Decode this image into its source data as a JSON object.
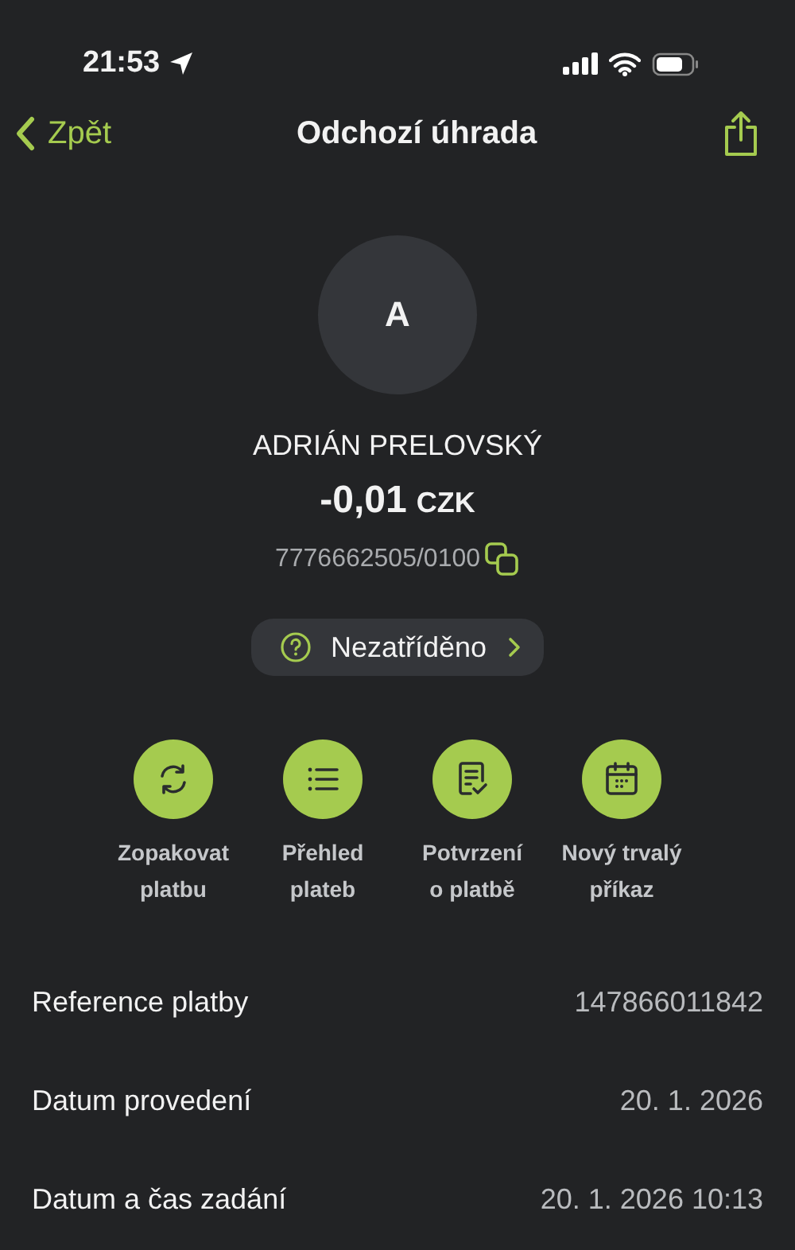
{
  "status_bar": {
    "time": "21:53"
  },
  "nav": {
    "back": "Zpět",
    "title": "Odchozí úhrada"
  },
  "counterparty": {
    "initial": "A",
    "name": "ADRIÁN PRELOVSKÝ",
    "amount": "-0,01",
    "currency": "CZK",
    "account": "7776662505/0100"
  },
  "category": {
    "label": "Nezatříděno"
  },
  "actions": [
    {
      "kind": "repeat",
      "label": "Zopakovat\nplatbu"
    },
    {
      "kind": "list",
      "label": "Přehled\nplateb"
    },
    {
      "kind": "receipt",
      "label": "Potvrzení\no platbě"
    },
    {
      "kind": "calendar",
      "label": "Nový trvalý\npříkaz"
    }
  ],
  "details": [
    {
      "label": "Reference platby",
      "value": "147866011842"
    },
    {
      "label": "Datum provedení",
      "value": "20. 1. 2026"
    },
    {
      "label": "Datum a čas zadání",
      "value": "20. 1. 2026 10:13"
    }
  ]
}
